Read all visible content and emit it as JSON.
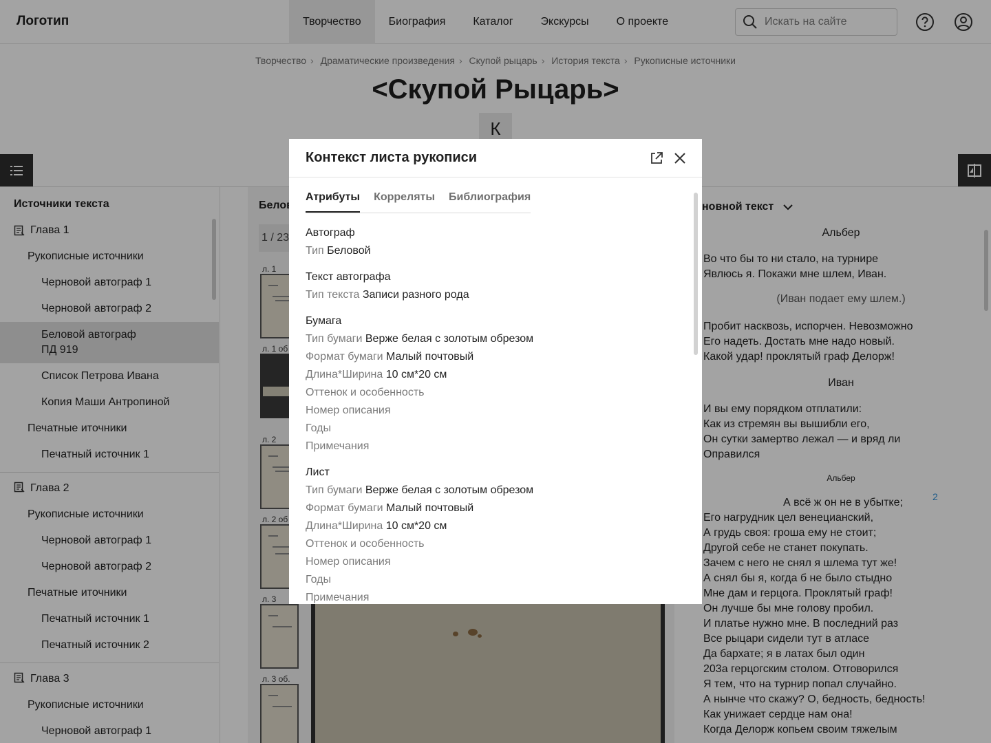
{
  "header": {
    "logo": "Логотип",
    "nav": [
      "Творчество",
      "Биография",
      "Каталог",
      "Экскурсы",
      "О проекте"
    ],
    "search_placeholder": "Искать на сайте"
  },
  "breadcrumb": [
    "Творчество",
    "Драматические произведения",
    "Скупой рыцарь",
    "История текста",
    "Рукописные источники"
  ],
  "page_title": "<Скупой Рыцарь>",
  "letter_tab": "К",
  "sidebar": {
    "title": "Источники текста",
    "items": [
      {
        "label": "Глава 1",
        "level": 0
      },
      {
        "label": "Рукописные источники",
        "level": 1
      },
      {
        "label": "Черновой автограф 1",
        "level": 2
      },
      {
        "label": "Черновой автограф 2",
        "level": 2
      },
      {
        "label": "Беловой автограф\nПД 919",
        "level": 2,
        "selected": true
      },
      {
        "label": "Список Петрова Ивана",
        "level": 2
      },
      {
        "label": "Копия Маши Антропиной",
        "level": 2
      },
      {
        "label": "Печатные иточники",
        "level": 1
      },
      {
        "label": "Печатный источник 1",
        "level": 2
      },
      {
        "label": "Глава 2",
        "level": 0
      },
      {
        "label": "Рукописные источники",
        "level": 1
      },
      {
        "label": "Черновой автограф 1",
        "level": 2
      },
      {
        "label": "Черновой автограф 2",
        "level": 2
      },
      {
        "label": "Печатные иточники",
        "level": 1
      },
      {
        "label": "Печатный источник 1",
        "level": 2
      },
      {
        "label": "Печатный источник 2",
        "level": 2
      },
      {
        "label": "Глава 3",
        "level": 0
      },
      {
        "label": "Рукописные источники",
        "level": 1
      },
      {
        "label": "Черновой автограф 1",
        "level": 2
      }
    ]
  },
  "viewer": {
    "title": "Белов",
    "pager": "1 / 23",
    "thumbs": [
      "л. 1",
      "л. 1 об",
      "л. 2",
      "л. 2 об",
      "л. 3",
      "л. 3 об."
    ]
  },
  "text_panel": {
    "heading": "новной текст",
    "speaker1": "Альбер",
    "lines1": [
      "Во что бы то ни стало, на турнире",
      "Явлюсь я. Покажи мне шлем, Иван."
    ],
    "stage1": "(Иван подает ему шлем.)",
    "lines2": [
      "Пробит насквозь, испорчен. Невозможно",
      "Его надеть. Достать мне надо новый.",
      "Какой удар! проклятый граф Делорж!"
    ],
    "speaker2": "Иван",
    "lines3": [
      "И вы ему порядком отплатили:",
      "Как из стремян вы вышибли его,",
      "Он сутки замертво лежал — и вряд ли",
      "Оправился"
    ],
    "speaker3": "Альбер",
    "line_number": "2",
    "line4_first": "А всё ж он не в убытке;",
    "lines4": [
      "Его нагрудник цел венецианский,",
      "А грудь своя: гроша ему не стоит;",
      "Другой себе не станет покупать.",
      "Зачем с него не снял я шлема тут же!",
      "А снял бы я, когда б не было стыдно",
      "Мне дам и герцога. Проклятый граф!",
      "Он лучше бы мне голову пробил.",
      "И платье нужно мне. В последний раз",
      "Все рыцари сидели тут в атласе",
      "Да бархате; я в латах был один",
      "203а герцогским столом. Отговорился",
      "Я тем, что на турнир попал случайно.",
      "А нынче что скажу? О, бедность, бедность!",
      "Как унижает сердце нам она!",
      "Когда Делорж копьем своим тяжелым"
    ]
  },
  "modal": {
    "title": "Контекст листа рукописи",
    "tabs": [
      "Атрибуты",
      "Корреляты",
      "Библиография"
    ],
    "sections": [
      {
        "title": "Автограф",
        "rows": [
          {
            "k": "Тип",
            "v": "Беловой"
          }
        ]
      },
      {
        "title": "Текст автографа",
        "rows": [
          {
            "k": "Тип текста",
            "v": "Записи разного рода"
          }
        ]
      },
      {
        "title": "Бумага",
        "rows": [
          {
            "k": "Тип бумаги",
            "v": "Верже белая с золотым обрезом"
          },
          {
            "k": "Формат бумаги",
            "v": "Малый почтовый"
          },
          {
            "k": "Длина*Ширина",
            "v": "10 см*20 см"
          },
          {
            "k": "Оттенок и особенность",
            "v": ""
          },
          {
            "k": "Номер описания",
            "v": ""
          },
          {
            "k": "Годы",
            "v": ""
          },
          {
            "k": "Примечания",
            "v": ""
          }
        ]
      },
      {
        "title": "Лист",
        "rows": [
          {
            "k": "Тип бумаги",
            "v": "Верже белая с золотым обрезом"
          },
          {
            "k": "Формат бумаги",
            "v": "Малый почтовый"
          },
          {
            "k": "Длина*Ширина",
            "v": "10 см*20 см"
          },
          {
            "k": "Оттенок и особенность",
            "v": ""
          },
          {
            "k": "Номер описания",
            "v": ""
          },
          {
            "k": "Годы",
            "v": ""
          },
          {
            "k": "Примечания",
            "v": ""
          }
        ]
      }
    ]
  }
}
